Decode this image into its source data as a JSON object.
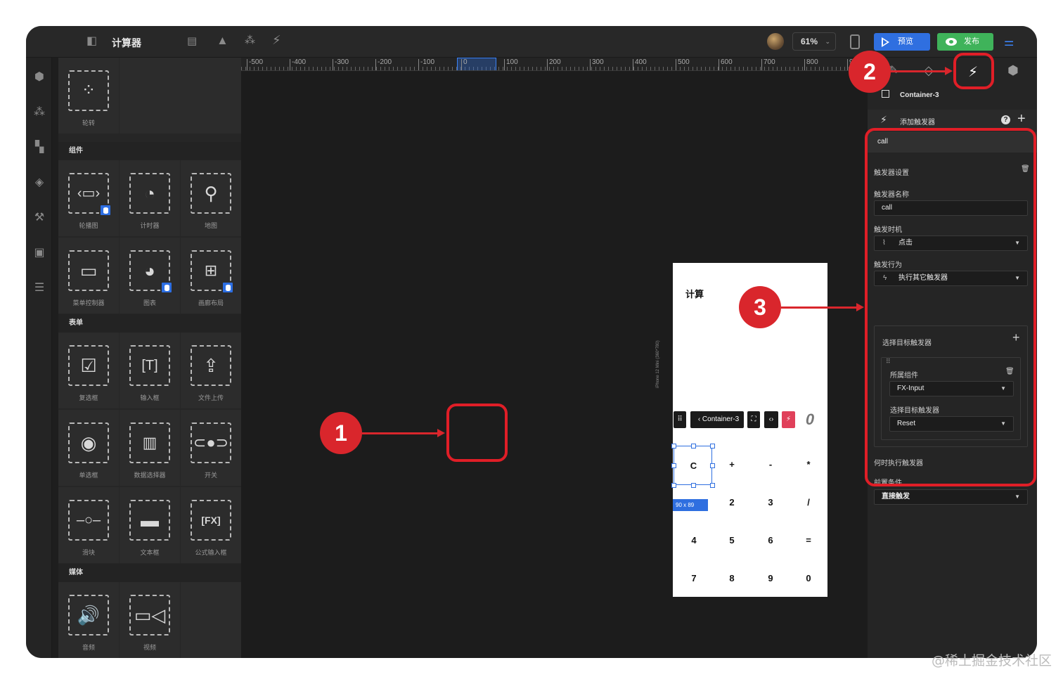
{
  "app": {
    "title": "计算器",
    "zoom": "61%",
    "preview_label": "预览",
    "publish_label": "发布"
  },
  "palette": {
    "top_item": "轮转",
    "sections": [
      {
        "title": "组件",
        "items": [
          "轮播图",
          "计时器",
          "地图",
          "菜单控制器",
          "图表",
          "画廊布局"
        ]
      },
      {
        "title": "表单",
        "items": [
          "复选框",
          "输入框",
          "文件上传",
          "单选框",
          "数据选择器",
          "开关",
          "滑块",
          "文本框",
          "公式输入框"
        ]
      },
      {
        "title": "媒体",
        "items": [
          "音频",
          "视频"
        ]
      }
    ]
  },
  "ruler": {
    "labels": [
      "-500",
      "-400",
      "-300",
      "-200",
      "-100",
      "0",
      "100",
      "200",
      "300",
      "400",
      "500",
      "600",
      "700",
      "800",
      "9"
    ]
  },
  "phone": {
    "title": "计算",
    "device_label": "iPhone 12 Mini (360*780)",
    "display": "0",
    "selected_key": "C",
    "size_badge": "90 x 89",
    "toolbar": {
      "container": "Container-3"
    },
    "keys": [
      [
        "C",
        "+",
        "-",
        "*"
      ],
      [
        "",
        "2",
        "3",
        "/"
      ],
      [
        "4",
        "5",
        "6",
        "="
      ],
      [
        "7",
        "8",
        "9",
        "0"
      ]
    ]
  },
  "inspector": {
    "component": "Container-3",
    "add_trigger": "添加触发器",
    "trigger_name_tab": "call",
    "settings_title": "触发器设置",
    "name_label": "触发器名称",
    "name_value": "call",
    "timing_label": "触发时机",
    "timing_value": "点击",
    "action_label": "触发行为",
    "action_value": "执行其它触发器",
    "target_title": "选择目标触发器",
    "owner_label": "所属组件",
    "owner_value": "FX-Input",
    "target_label": "选择目标触发器",
    "target_value": "Reset",
    "when_title": "何时执行触发器",
    "condition_label": "前置条件",
    "condition_value": "直接触发"
  },
  "annotations": [
    "1",
    "2",
    "3"
  ],
  "watermark": "@稀土掘金技术社区",
  "colors": {
    "accent": "#2f6fe0",
    "publish": "#3fb35a",
    "annotation": "#d9262c",
    "trigger_tab": "#e0405a"
  }
}
